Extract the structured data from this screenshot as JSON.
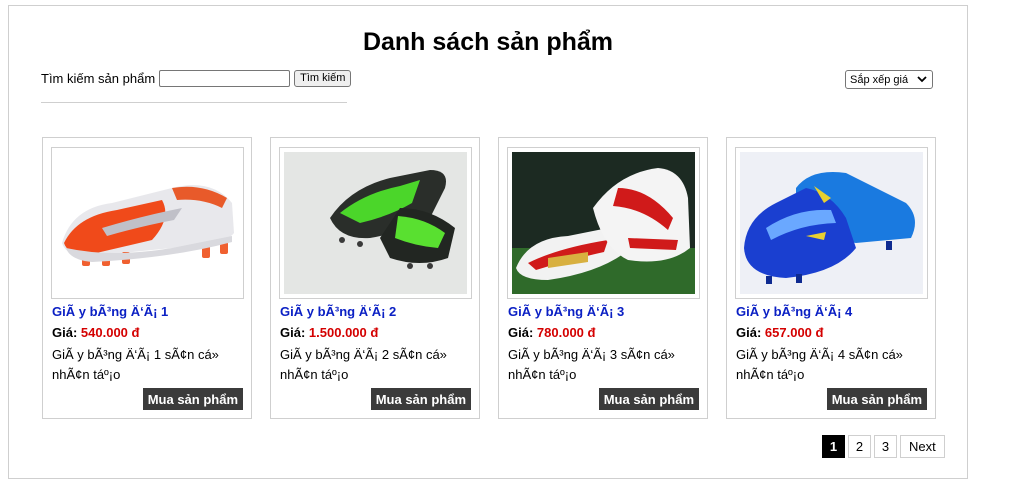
{
  "page_title": "Danh sách sản phẩm",
  "search": {
    "label": "Tìm kiếm sản phẩm",
    "value": "",
    "button_label": "Tìm kiếm"
  },
  "sort": {
    "selected": "Sắp xếp giá"
  },
  "products": [
    {
      "name": "GiÃ y bÃ³ng Ä‘Ã¡ 1",
      "price_label": "Giá:",
      "price": "540.000 đ",
      "description": "GiÃ y bÃ³ng Ä‘Ã¡ 1 sÃ¢n cá» nhÃ¢n táº¡o",
      "buy_label": "Mua sản phẩm"
    },
    {
      "name": "GiÃ y bÃ³ng Ä‘Ã¡ 2",
      "price_label": "Giá:",
      "price": "1.500.000 đ",
      "description": "GiÃ y bÃ³ng Ä‘Ã¡ 2 sÃ¢n cá» nhÃ¢n táº¡o",
      "buy_label": "Mua sản phẩm"
    },
    {
      "name": "GiÃ y bÃ³ng Ä‘Ã¡ 3",
      "price_label": "Giá:",
      "price": "780.000 đ",
      "description": "GiÃ y bÃ³ng Ä‘Ã¡ 3 sÃ¢n cá» nhÃ¢n táº¡o",
      "buy_label": "Mua sản phẩm"
    },
    {
      "name": "GiÃ y bÃ³ng Ä‘Ã¡ 4",
      "price_label": "Giá:",
      "price": "657.000 đ",
      "description": "GiÃ y bÃ³ng Ä‘Ã¡ 4 sÃ¢n cá» nhÃ¢n táº¡o",
      "buy_label": "Mua sản phẩm"
    }
  ],
  "pagination": {
    "pages": [
      "1",
      "2",
      "3"
    ],
    "current": "1",
    "next_label": "Next"
  },
  "colors": {
    "product_name": "#0b20c4",
    "price_value": "#d40000",
    "buy_button": "#3b3b3b",
    "active_page": "#000000"
  }
}
